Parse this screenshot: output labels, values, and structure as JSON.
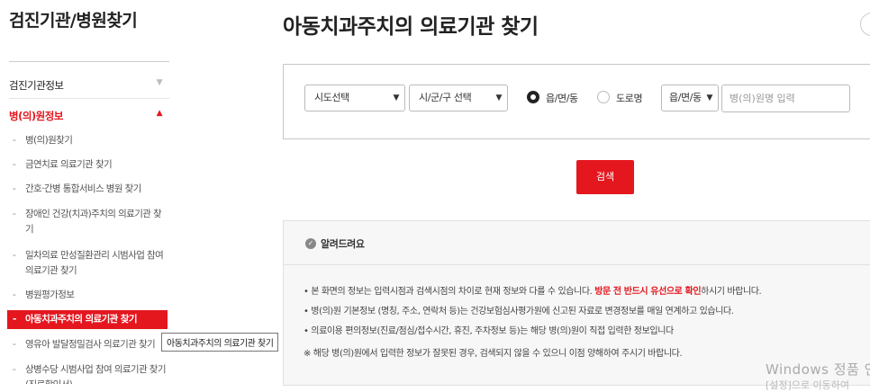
{
  "sidebar": {
    "title": "검진기관/병원찾기",
    "categories": [
      {
        "label": "검진기관정보",
        "arrow": "▼"
      },
      {
        "label": "병(의)원정보",
        "arrow": "▲"
      }
    ],
    "items": [
      {
        "label": "병(의)원찾기"
      },
      {
        "label": "금연치료 의료기관 찾기"
      },
      {
        "label": "간호·간병 통합서비스 병원 찾기"
      },
      {
        "label": "장애인 건강(치과)주치의 의료기관 찾기"
      },
      {
        "label": "일차의료 만성질환관리 시범사업 참여 의료기관 찾기"
      },
      {
        "label": "병원평가정보"
      },
      {
        "label": "아동치과주치의 의료기관 찾기"
      },
      {
        "label": "영유아 발달정밀검사 의료기관 찾기"
      },
      {
        "label": "상병수당 시범사업 참여 의료기관 찾기(진료확인서)"
      }
    ],
    "tooltip": "아동치과주치의 의료기관 찾기"
  },
  "main": {
    "title": "아동치과주치의 의료기관 찾기",
    "search": {
      "sido": "시도선택",
      "sigungu": "시/군/구 선택",
      "radio1": "읍/면/동",
      "radio2": "도로명",
      "type_select": "읍/면/동",
      "name_placeholder": "병(의)원명 입력",
      "button": "검색"
    },
    "notice": {
      "title": "알려드려요",
      "line1_a": "본 화면의 정보는 입력시점과 검색시점의 차이로 현재 정보와 다를 수 있습니다.",
      "line1_hl": "방문 전 반드시 유선으로 확인",
      "line1_b": "하시기 바랍니다.",
      "line2": "병(의)원 기본정보 (명칭, 주소, 연락처 등)는 건강보험심사평가원에 신고된 자료로 변경정보를 매일 연계하고 있습니다.",
      "line3": "의료이용 편의정보(진료/점심/접수시간, 휴진, 주차정보 등)는 해당 병(의)원이 직접 입력한 정보입니다",
      "line4": "해당 병(의)원에서 입력한 정보가 잘못된 경우, 검색되지 않을 수 있으니 이점 양해하여 주시기 바랍니다."
    },
    "bullets": [
      "•",
      "•",
      "•",
      "※"
    ]
  },
  "watermark": {
    "line1": "Windows 정품 인",
    "line2": "[설정]으로 이동하여"
  },
  "colors": {
    "accent": "#e4171f"
  }
}
